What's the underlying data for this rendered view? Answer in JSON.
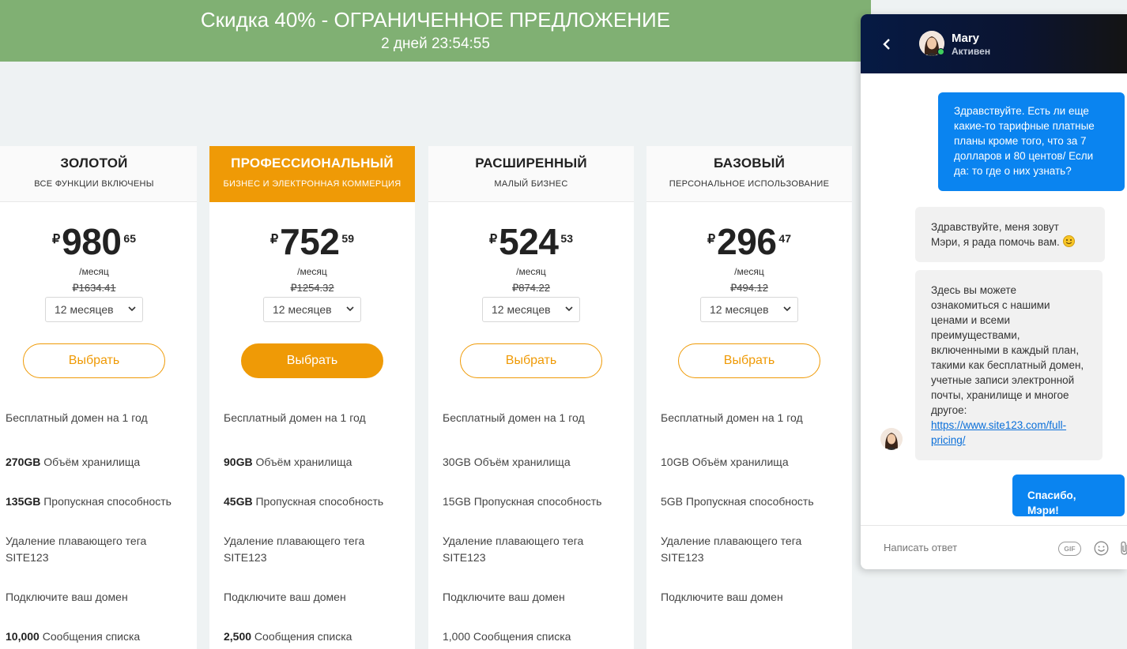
{
  "promo": {
    "title": "Скидка 40% - ОГРАНИЧЕННОЕ ПРЕДЛОЖЕНИЕ",
    "timer": "2 дней 23:54:55"
  },
  "colors": {
    "accent": "#ef9a06",
    "promo_bg": "#80b073",
    "chat_blue": "#0a84f0"
  },
  "plans": [
    {
      "name": "ЗОЛОТОЙ",
      "subtitle": "ВСЕ ФУНКЦИИ ВКЛЮЧЕНЫ",
      "currency": "₽",
      "price_main": "980",
      "price_cents": "65",
      "period": "/месяц",
      "old_price": "₽1634.41",
      "term": "12 месяцев",
      "button": "Выбрать",
      "features": [
        {
          "bold": "",
          "text": "Бесплатный домен на 1 год"
        },
        {
          "bold": "270GB",
          "text": " Объём хранилища"
        },
        {
          "bold": "135GB",
          "text": " Пропускная способность"
        },
        {
          "bold": "",
          "text": "Удаление плавающего тега SITE123"
        },
        {
          "bold": "",
          "text": "Подключите ваш домен"
        },
        {
          "bold": "10,000",
          "text": " Сообщения списка"
        }
      ]
    },
    {
      "name": "ПРОФЕССИОНАЛЬНЫЙ",
      "subtitle": "БИЗНЕС И ЭЛЕКТРОННАЯ КОММЕРЦИЯ",
      "currency": "₽",
      "price_main": "752",
      "price_cents": "59",
      "period": "/месяц",
      "old_price": "₽1254.32",
      "term": "12 месяцев",
      "button": "Выбрать",
      "features": [
        {
          "bold": "",
          "text": "Бесплатный домен на 1 год"
        },
        {
          "bold": "90GB",
          "text": " Объём хранилища"
        },
        {
          "bold": "45GB",
          "text": " Пропускная способность"
        },
        {
          "bold": "",
          "text": "Удаление плавающего тега SITE123"
        },
        {
          "bold": "",
          "text": "Подключите ваш домен"
        },
        {
          "bold": "2,500",
          "text": " Сообщения списка"
        }
      ]
    },
    {
      "name": "РАСШИРЕННЫЙ",
      "subtitle": "МАЛЫЙ БИЗНЕС",
      "currency": "₽",
      "price_main": "524",
      "price_cents": "53",
      "period": "/месяц",
      "old_price": "₽874.22",
      "term": "12 месяцев",
      "button": "Выбрать",
      "features": [
        {
          "bold": "",
          "text": "Бесплатный домен на 1 год"
        },
        {
          "bold": "",
          "text": "30GB Объём хранилища"
        },
        {
          "bold": "",
          "text": "15GB Пропускная способность"
        },
        {
          "bold": "",
          "text": "Удаление плавающего тега SITE123"
        },
        {
          "bold": "",
          "text": "Подключите ваш домен"
        },
        {
          "bold": "",
          "text": "1,000 Сообщения списка"
        }
      ]
    },
    {
      "name": "БАЗОВЫЙ",
      "subtitle": "ПЕРСОНАЛЬНОЕ ИСПОЛЬЗОВАНИЕ",
      "currency": "₽",
      "price_main": "296",
      "price_cents": "47",
      "period": "/месяц",
      "old_price": "₽494.12",
      "term": "12 месяцев",
      "button": "Выбрать",
      "features": [
        {
          "bold": "",
          "text": "Бесплатный домен на 1 год"
        },
        {
          "bold": "",
          "text": "10GB Объём хранилища"
        },
        {
          "bold": "",
          "text": "5GB Пропускная способность"
        },
        {
          "bold": "",
          "text": "Удаление плавающего тега SITE123"
        },
        {
          "bold": "",
          "text": "Подключите ваш домен"
        }
      ]
    }
  ],
  "chat": {
    "agent_name": "Mary",
    "agent_status": "Активен",
    "messages": [
      {
        "from": "user",
        "text": "Здравствуйте. Есть ли еще какие-то тарифные платные планы кроме того, что за 7 долларов и 80 центов/ Если да: то где о них узнать?"
      },
      {
        "from": "agent",
        "text": "Здравствуйте, меня зовут Мэри, я рада помочь вам."
      },
      {
        "from": "agent",
        "text": "Здесь вы можете ознакомиться с нашими ценами и всеми преимуществами, включенными в каждый план, такими как бесплатный домен, учетные записи электронной почты, хранилище и многое другое:",
        "link": "https://www.site123.com/full-pricing/"
      },
      {
        "from": "user",
        "text": "Спасибо, Мэри!"
      }
    ],
    "reply_placeholder": "Написать ответ",
    "gif_label": "GIF"
  }
}
